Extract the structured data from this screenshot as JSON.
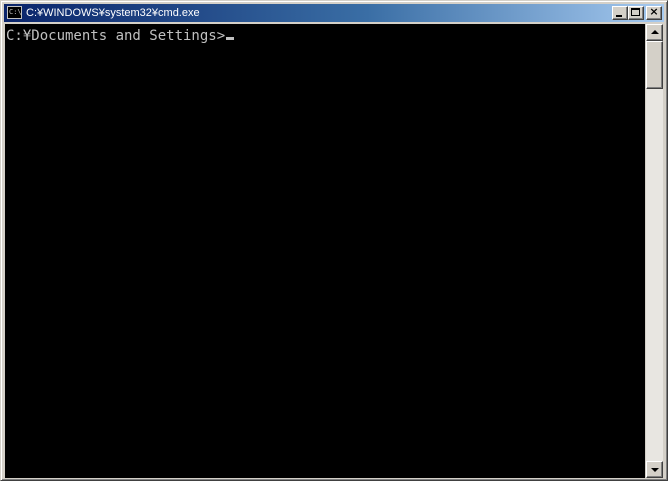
{
  "window": {
    "title": "C:¥WINDOWS¥system32¥cmd.exe",
    "icon_text": "C:\\",
    "icon": "console-app-icon",
    "buttons": {
      "minimize_icon": "minimize-icon",
      "maximize_icon": "maximize-icon",
      "close_glyph": "×"
    }
  },
  "console": {
    "prompt": "C:¥Documents and Settings>",
    "foreground": "#c0c0c0",
    "background": "#000000"
  },
  "scrollbar": {
    "up_icon": "scroll-up-arrow-icon",
    "down_icon": "scroll-down-arrow-icon"
  },
  "colors": {
    "titlebar_start": "#0a246a",
    "titlebar_end": "#a6caf0",
    "chrome": "#d4d0c8"
  }
}
